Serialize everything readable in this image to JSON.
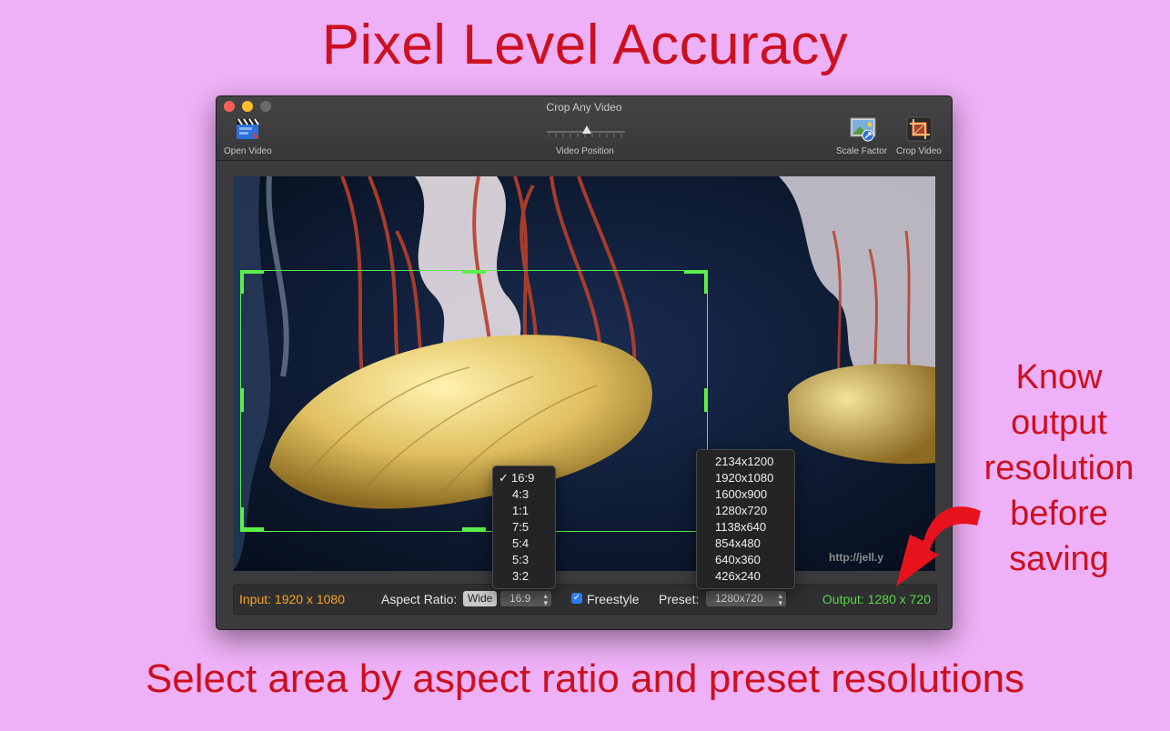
{
  "headline": "Pixel Level Accuracy",
  "footline": "Select area by aspect ratio and preset resolutions",
  "side_note": [
    "Know",
    "output",
    "resolution",
    "before",
    "saving"
  ],
  "window": {
    "title": "Crop Any Video",
    "toolbar": {
      "open_video": "Open Video",
      "video_position": "Video Position",
      "scale_factor": "Scale Factor",
      "crop_video": "Crop Video"
    }
  },
  "video": {
    "watermark": "http://jell.y"
  },
  "statusbar": {
    "input": "Input: 1920 x 1080",
    "aspect_label": "Aspect Ratio:",
    "wide_button": "Wide",
    "aspect_value": "16:9",
    "freestyle_label": "Freestyle",
    "freestyle_checked": true,
    "preset_label": "Preset:",
    "preset_value": "1280x720",
    "output": "Output: 1280 x 720"
  },
  "aspect_menu": {
    "checkmark": "✓",
    "items": [
      "16:9",
      "4:3",
      "1:1",
      "7:5",
      "5:4",
      "5:3",
      "3:2"
    ],
    "selected": "16:9"
  },
  "preset_menu": {
    "items": [
      "2134x1200",
      "1920x1080",
      "1600x900",
      "1280x720",
      "1138x640",
      "854x480",
      "640x360",
      "426x240"
    ]
  },
  "colors": {
    "background": "#eeb0f6",
    "headline": "#cc1020",
    "input_text": "#f5a623",
    "output_text": "#5ad64a",
    "crop_border": "#5af04a"
  }
}
